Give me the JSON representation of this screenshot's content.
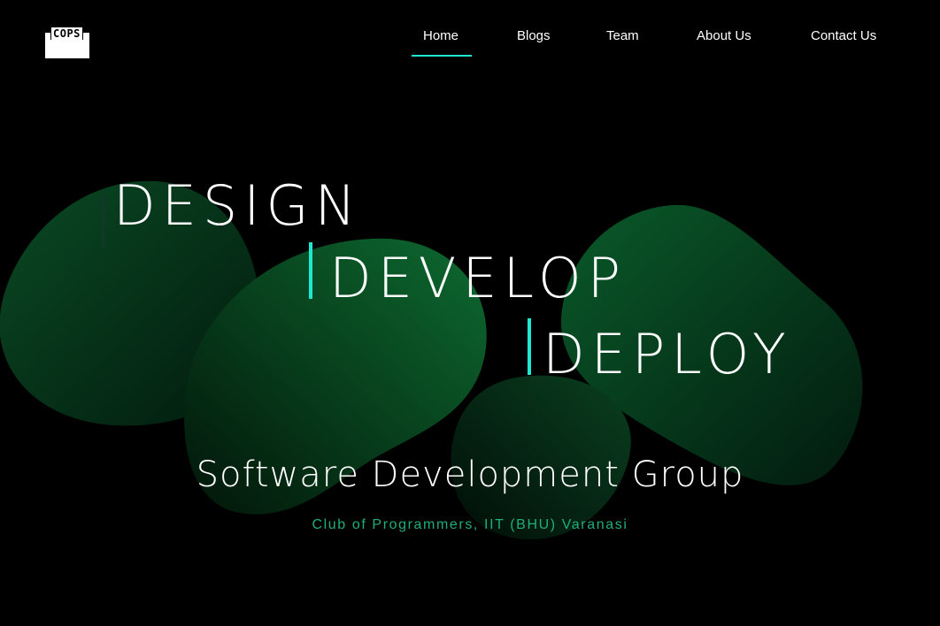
{
  "brand": {
    "logo_text": "COPS"
  },
  "nav": {
    "items": [
      {
        "label": "Home",
        "active": true
      },
      {
        "label": "Blogs",
        "active": false
      },
      {
        "label": "Team",
        "active": false
      },
      {
        "label": "About Us",
        "active": false
      },
      {
        "label": "Contact Us",
        "active": false
      }
    ]
  },
  "hero": {
    "words": [
      "DESIGN",
      "DEVELOP",
      "DEPLOY"
    ],
    "title": "Software Development Group",
    "tagline": "Club of Programmers, IIT (BHU) Varanasi"
  },
  "theme": {
    "background": "#000000",
    "accent": "#1de9d3",
    "tagline_color": "#1fae7f",
    "blob_color": "#0b5a2c"
  }
}
